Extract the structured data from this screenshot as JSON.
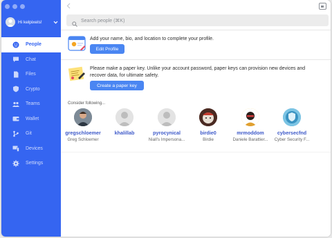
{
  "sidebar": {
    "user_label": "Hi kelpixels!",
    "items": [
      {
        "label": "People",
        "icon": "people-icon",
        "active": true
      },
      {
        "label": "Chat",
        "icon": "chat-icon",
        "active": false
      },
      {
        "label": "Files",
        "icon": "files-icon",
        "active": false
      },
      {
        "label": "Crypto",
        "icon": "crypto-icon",
        "active": false
      },
      {
        "label": "Teams",
        "icon": "teams-icon",
        "active": false
      },
      {
        "label": "Wallet",
        "icon": "wallet-icon",
        "active": false
      },
      {
        "label": "Git",
        "icon": "git-icon",
        "active": false
      },
      {
        "label": "Devices",
        "icon": "devices-icon",
        "active": false
      },
      {
        "label": "Settings",
        "icon": "settings-icon",
        "active": false
      }
    ]
  },
  "search": {
    "placeholder": "Search people (⌘K)"
  },
  "profile_banner": {
    "text": "Add your name, bio, and location to complete your profile.",
    "button_label": "Edit Profile"
  },
  "paperkey_banner": {
    "text_line1": "Please make a paper key. Unlike your account password, paper keys can provision new devices and",
    "text_line2": "recover data, for ultimate safety.",
    "button_label": "Create a paper key"
  },
  "suggestions": {
    "heading": "Consider following...",
    "people": [
      {
        "username": "gregschloemer",
        "fullname": "Greg Schloemer"
      },
      {
        "username": "khalillab",
        "fullname": ""
      },
      {
        "username": "pyrocynical",
        "fullname": "Niall's Impersona..."
      },
      {
        "username": "birdie0",
        "fullname": "Birdie"
      },
      {
        "username": "mrmoddom",
        "fullname": "Daniele Barattier..."
      },
      {
        "username": "cybersecfnd",
        "fullname": "Cyber Security F..."
      }
    ]
  },
  "colors": {
    "brand": "#3565f1",
    "button": "#4a86f2",
    "link": "#3d59c9"
  }
}
